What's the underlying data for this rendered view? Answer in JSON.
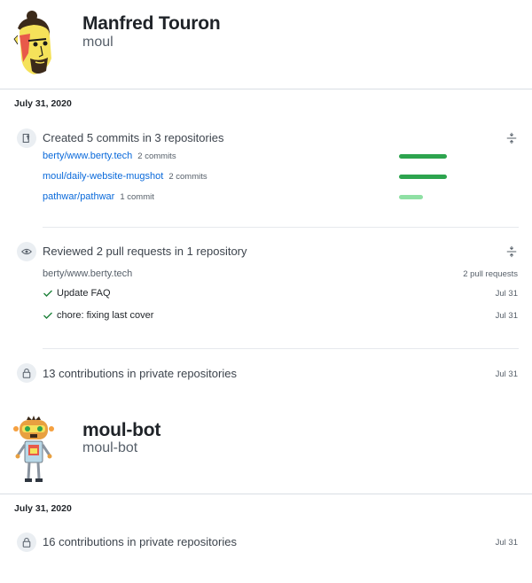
{
  "users": [
    {
      "name": "Manfred Touron",
      "login": "moul",
      "date": "July 31, 2020",
      "commits": {
        "title": "Created 5 commits in 3 repositories",
        "repos": [
          {
            "repo": "berty/www.berty.tech",
            "count": "2 commits",
            "share": 1.0
          },
          {
            "repo": "moul/daily-website-mugshot",
            "count": "2 commits",
            "share": 1.0
          },
          {
            "repo": "pathwar/pathwar",
            "count": "1 commit",
            "share": 0.5
          }
        ]
      },
      "reviews": {
        "title": "Reviewed 2 pull requests in 1 repository",
        "repo": "berty/www.berty.tech",
        "count": "2 pull requests",
        "items": [
          {
            "title": "Update FAQ",
            "date": "Jul 31"
          },
          {
            "title": "chore: fixing last cover",
            "date": "Jul 31"
          }
        ]
      },
      "private": {
        "title": "13 contributions in private repositories",
        "date": "Jul 31"
      }
    },
    {
      "name": "moul-bot",
      "login": "moul-bot",
      "date": "July 31, 2020",
      "private": {
        "title": "16 contributions in private repositories",
        "date": "Jul 31"
      }
    }
  ],
  "colors": {
    "bar_full": "#2da44e",
    "bar_light": "#8fe0a4",
    "link": "#0969da",
    "check": "#1a7f37"
  }
}
